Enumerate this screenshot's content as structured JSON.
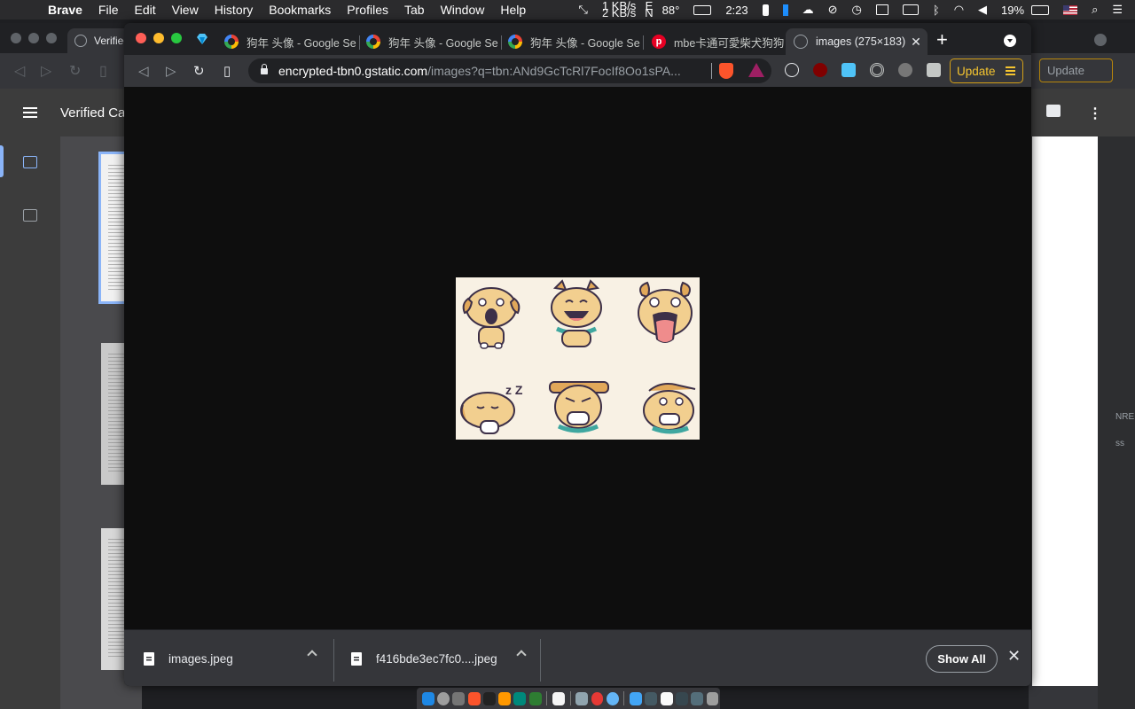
{
  "menubar": {
    "app_name": "Brave",
    "items": [
      "File",
      "Edit",
      "View",
      "History",
      "Bookmarks",
      "Profiles",
      "Tab",
      "Window",
      "Help"
    ],
    "net_up": "1 KB/s",
    "net_down": "2 KB/s",
    "temp_e": "E",
    "temp_n": "N",
    "temperature": "88°",
    "time": "2:23",
    "battery": "19%"
  },
  "bg_window": {
    "tab_title": "Verified",
    "doc_title": "Verified Ca"
  },
  "bg_right_window": {
    "update_label": "Update",
    "edge_text_1": "NRE",
    "edge_text_2": "ss"
  },
  "tabs": [
    {
      "title": "狗年 头像 - Google Se",
      "favicon": "google-icon",
      "active": false
    },
    {
      "title": "狗年 头像 - Google Se",
      "favicon": "google-icon",
      "active": false
    },
    {
      "title": "狗年 头像 - Google Se",
      "favicon": "google-icon",
      "active": false
    },
    {
      "title": "mbe卡通可愛柴犬狗狗",
      "favicon": "pinterest-icon",
      "active": false
    },
    {
      "title": "images (275×183)",
      "favicon": "globe-icon",
      "active": true
    }
  ],
  "tab_close_glyph": "✕",
  "new_tab_glyph": "+",
  "address_bar": {
    "host": "encrypted-tbn0.gstatic.com",
    "path": "/images?q=tbn:ANd9GcTcRl7FocIf8Oo1sPA..."
  },
  "toolbar": {
    "update_label": "Update"
  },
  "image": {
    "stickers": 6,
    "sleep_glyph": "z Z"
  },
  "downloads": {
    "items": [
      {
        "name": "images.jpeg"
      },
      {
        "name": "f416bde3ec7fc0....jpeg"
      }
    ],
    "show_all_label": "Show All",
    "close_glyph": "✕"
  },
  "colors": {
    "accent": "#8ab4f8",
    "update_border": "#d4a017",
    "brave_orange": "#fb542b",
    "viewport_bg": "#0e0e0e"
  }
}
